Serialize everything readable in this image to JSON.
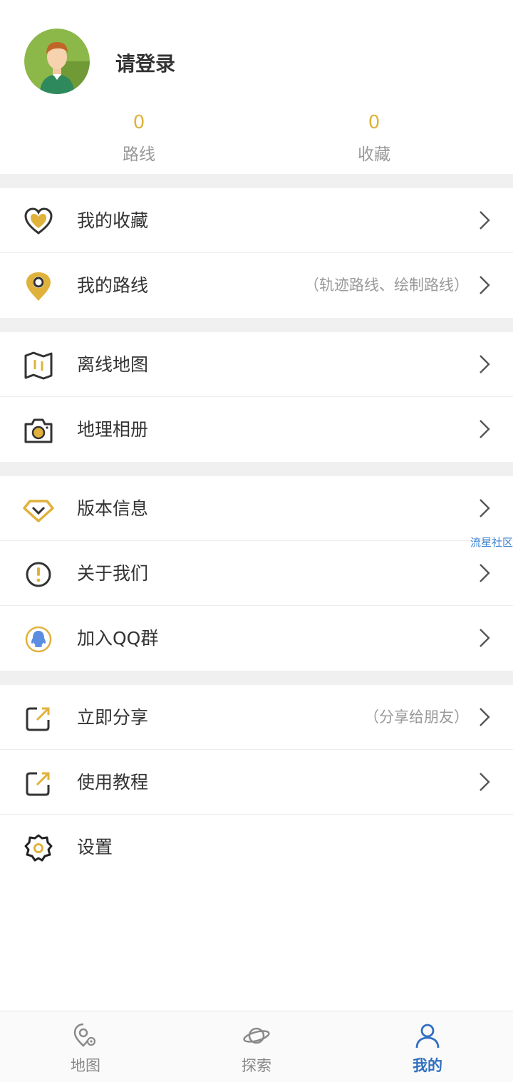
{
  "profile": {
    "login_text": "请登录",
    "stats": [
      {
        "value": "0",
        "label": "路线"
      },
      {
        "value": "0",
        "label": "收藏"
      }
    ]
  },
  "menu": {
    "favorites": {
      "label": "我的收藏",
      "icon": "heart-icon"
    },
    "routes": {
      "label": "我的路线",
      "hint": "（轨迹路线、绘制路线）",
      "icon": "location-pin-icon"
    },
    "offline_map": {
      "label": "离线地图",
      "icon": "map-icon"
    },
    "geo_album": {
      "label": "地理相册",
      "icon": "camera-icon"
    },
    "version_info": {
      "label": "版本信息",
      "icon": "diamond-icon"
    },
    "about": {
      "label": "关于我们",
      "icon": "info-icon"
    },
    "join_qq": {
      "label": "加入QQ群",
      "icon": "qq-icon"
    },
    "share": {
      "label": "立即分享",
      "hint": "（分享给朋友）",
      "icon": "share-icon"
    },
    "tutorial": {
      "label": "使用教程",
      "icon": "share-icon"
    },
    "settings": {
      "label": "设置",
      "icon": "gear-icon"
    }
  },
  "watermark": "流星社区",
  "tabbar": {
    "tabs": [
      {
        "label": "地图",
        "icon": "map-pin-icon"
      },
      {
        "label": "探索",
        "icon": "planet-icon"
      },
      {
        "label": "我的",
        "icon": "user-icon",
        "active": true
      }
    ]
  },
  "colors": {
    "accent_gold": "#e0b23c",
    "active_blue": "#2f6fc1",
    "separator": "#f0f0f0"
  }
}
